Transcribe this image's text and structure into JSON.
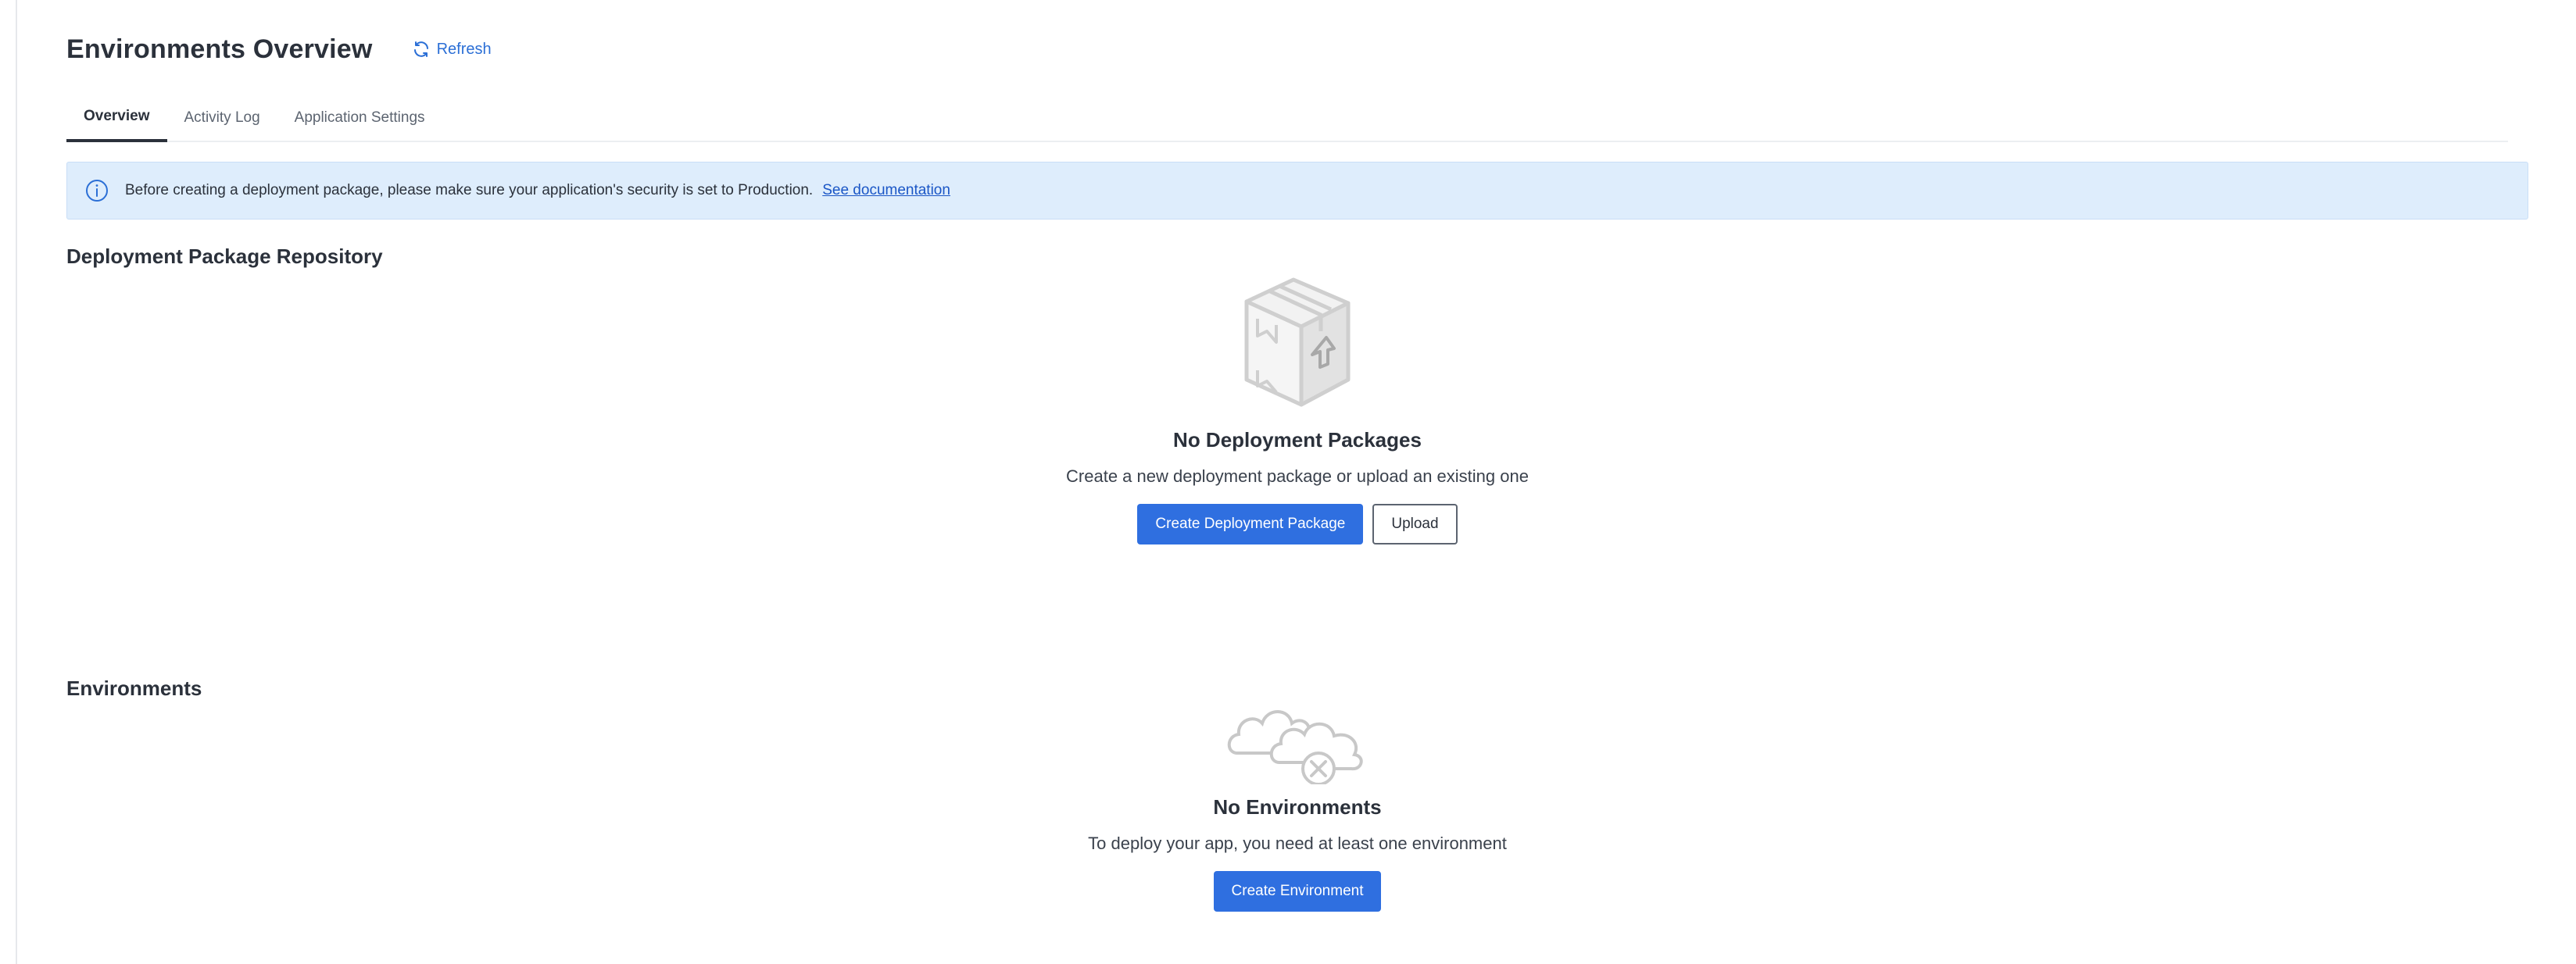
{
  "header": {
    "title": "Environments Overview",
    "refresh_label": "Refresh"
  },
  "tabs": [
    {
      "label": "Overview",
      "active": true
    },
    {
      "label": "Activity Log",
      "active": false
    },
    {
      "label": "Application Settings",
      "active": false
    }
  ],
  "banner": {
    "message": "Before creating a deployment package, please make sure your application's security is set to Production.",
    "link_label": "See documentation"
  },
  "repository": {
    "heading": "Deployment Package Repository",
    "empty_icon": "package-box-icon",
    "empty_title": "No Deployment Packages",
    "empty_desc": "Create a new deployment package or upload an existing one",
    "create_label": "Create Deployment Package",
    "upload_label": "Upload"
  },
  "environments": {
    "heading": "Environments",
    "empty_icon": "cloud-error-icon",
    "empty_title": "No Environments",
    "empty_desc": "To deploy your app, you need at least one environment",
    "create_label": "Create Environment"
  },
  "colors": {
    "accent": "#2f6fe0",
    "link": "#2b6fd6",
    "banner_bg": "#deedfc",
    "text": "#2b313b"
  }
}
